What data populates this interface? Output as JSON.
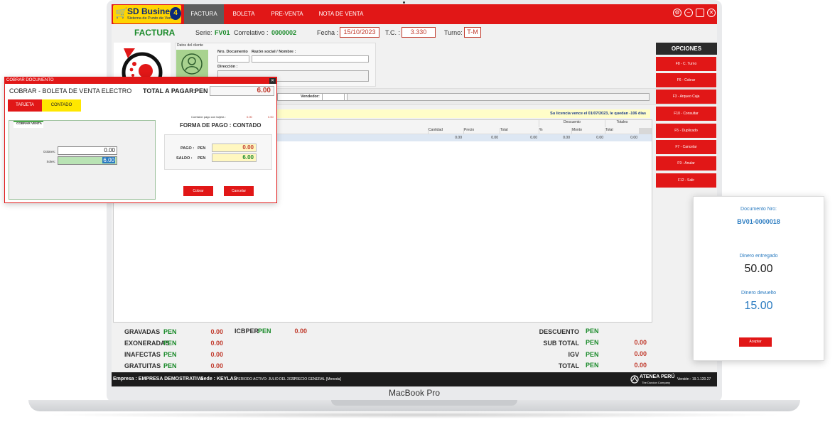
{
  "device": {
    "label": "MacBook Pro"
  },
  "app": {
    "logo": {
      "name": "SD Business",
      "subtitle": "Sistema de Punto de Venta",
      "badge": "4"
    },
    "tabs": [
      "FACTURA",
      "BOLETA",
      "PRE-VENTA",
      "NOTA DE VENTA"
    ],
    "window_icons": [
      "gear-icon",
      "minimize-icon",
      "maximize-icon",
      "close-icon"
    ]
  },
  "header": {
    "title": "FACTURA",
    "serie_label": "Serie:",
    "serie": "FV01",
    "correlativo_label": "Correlativo :",
    "correlativo": "0000002",
    "fecha_label": "Fecha :",
    "fecha": "15/10/2023",
    "tc_label": "T.C. :",
    "tc": "3.330",
    "turno_label": "Turno:",
    "turno": "T-M"
  },
  "client": {
    "datos_label": "Datos del cliente",
    "nro_doc_label": "Nro. Documento",
    "razon_label": "Razón social / Nombre :",
    "direccion_label": "Dirección :",
    "vendedor_label": "Vendedor:"
  },
  "license": {
    "message": "Su licencia vence el 01/07/2023, le quedan -106 días"
  },
  "grid": {
    "groups": [
      "Descuento",
      "Totales"
    ],
    "columns": [
      "Cantidad",
      "Precio",
      "Total",
      "%",
      "Monto",
      "Total"
    ],
    "row": [
      "0.00",
      "0.00",
      "0.00",
      "0.00",
      "0.00",
      "0.00"
    ]
  },
  "opciones": {
    "title": "OPCIONES",
    "buttons": [
      "F8 - C. Turno",
      "F6 - Cobrar",
      "F3 - Arqueo Caja",
      "F10 - Consultar",
      "F5 - Duplicado",
      "F7 - Cancelar",
      "F9 - Anular",
      "F12 - Salir"
    ]
  },
  "totals": {
    "left": [
      {
        "label": "GRAVADAS",
        "currency": "PEN",
        "value": "0.00"
      },
      {
        "label": "EXONERADAS",
        "currency": "PEN",
        "value": "0.00"
      },
      {
        "label": "INAFECTAS",
        "currency": "PEN",
        "value": "0.00"
      },
      {
        "label": "GRATUITAS",
        "currency": "PEN",
        "value": "0.00"
      }
    ],
    "icbper": {
      "label": "ICBPER",
      "currency": "PEN",
      "value": "0.00"
    },
    "right": [
      {
        "label": "DESCUENTO",
        "currency": "PEN",
        "value": ""
      },
      {
        "label": "SUB TOTAL",
        "currency": "PEN",
        "value": "0.00"
      },
      {
        "label": "IGV",
        "currency": "PEN",
        "value": "0.00"
      },
      {
        "label": "TOTAL",
        "currency": "PEN",
        "value": "0.00"
      }
    ]
  },
  "status": {
    "empresa": "Empresa : EMPRESA DEMOSTRATIVA",
    "sede": "Sede : KEYLAS",
    "periodo": "PERIODO ACTIVO: JULIO DEL 2023",
    "precio": "PRECIO GENERAL",
    "moneda": "[Moneda]",
    "brand": "ATENEA PERÚ",
    "brand_sub": "The Durcion Company",
    "version": "Versión : 19.1.120.27"
  },
  "dialog": {
    "title": "COBRAR DOCUMENTO",
    "heading": "COBRAR - BOLETA DE VENTA ELECTRO",
    "total_label": "TOTAL A PAGAR:",
    "total_currency": "PEN",
    "total_value": "6.00",
    "tabs": [
      "TARJETA",
      "CONTADO"
    ],
    "panel_tab": "COBRAR VENTA",
    "dolares_label": "Dolares:",
    "dolares_value": "0.00",
    "soles_label": "Soles:",
    "soles_value": "6.00",
    "comision_label": "Comisión pago con tarjeta :",
    "comision_values": [
      "0.00",
      "0.00"
    ],
    "forma_pago": "FORMA DE PAGO : CONTADO",
    "pago_label": "PAGO :",
    "pago_currency": "PEN",
    "pago_value": "0.00",
    "saldo_label": "SALDO :",
    "saldo_currency": "PEN",
    "saldo_value": "6.00",
    "cobrar_button": "Cobrar",
    "cancelar_button": "Cancelar"
  },
  "receipt": {
    "doc_label": "Documento Nro:",
    "doc_number": "BV01-0000018",
    "entregado_label": "Dinero entregado",
    "entregado_value": "50.00",
    "devuelto_label": "Dinero devuelto",
    "devuelto_value": "15.00",
    "accept_button": "Aceptar"
  },
  "colors": {
    "brand_red": "#e11717",
    "logo_yellow": "#ffd400",
    "green_text": "#1a8a2a",
    "value_red": "#c0392b",
    "link_blue": "#2a7bc0"
  }
}
